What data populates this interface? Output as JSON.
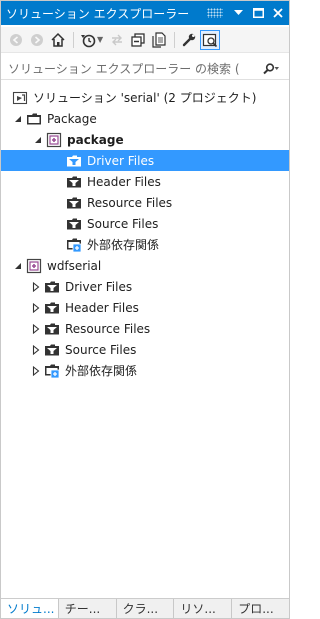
{
  "window": {
    "title": "ソリューション エクスプローラー",
    "pin_icon": "dropdown-arrow",
    "maximize_icon": "maximize",
    "close_icon": "close"
  },
  "toolbar": {
    "items": [
      "back",
      "forward",
      "home",
      "history",
      "sync",
      "collapse-all",
      "show-all-files",
      "properties",
      "preview"
    ]
  },
  "search": {
    "placeholder": "ソリューション エクスプローラー の検索 ("
  },
  "tree": {
    "solution": "ソリューション 'serial' (2 プロジェクト)",
    "package_folder": "Package",
    "package_project": "package",
    "package_children": [
      {
        "label": "Driver Files"
      },
      {
        "label": "Header Files"
      },
      {
        "label": "Resource Files"
      },
      {
        "label": "Source Files"
      },
      {
        "label": "外部依存関係"
      }
    ],
    "wdf_project": "wdfserial",
    "wdf_children": [
      {
        "label": "Driver Files"
      },
      {
        "label": "Header Files"
      },
      {
        "label": "Resource Files"
      },
      {
        "label": "Source Files"
      },
      {
        "label": "外部依存関係"
      }
    ]
  },
  "tabs": [
    "ソリュ...",
    "チー...",
    "クラ...",
    "リソ...",
    "プロ..."
  ],
  "colors": {
    "accent": "#007acc",
    "selection": "#3399ff"
  }
}
